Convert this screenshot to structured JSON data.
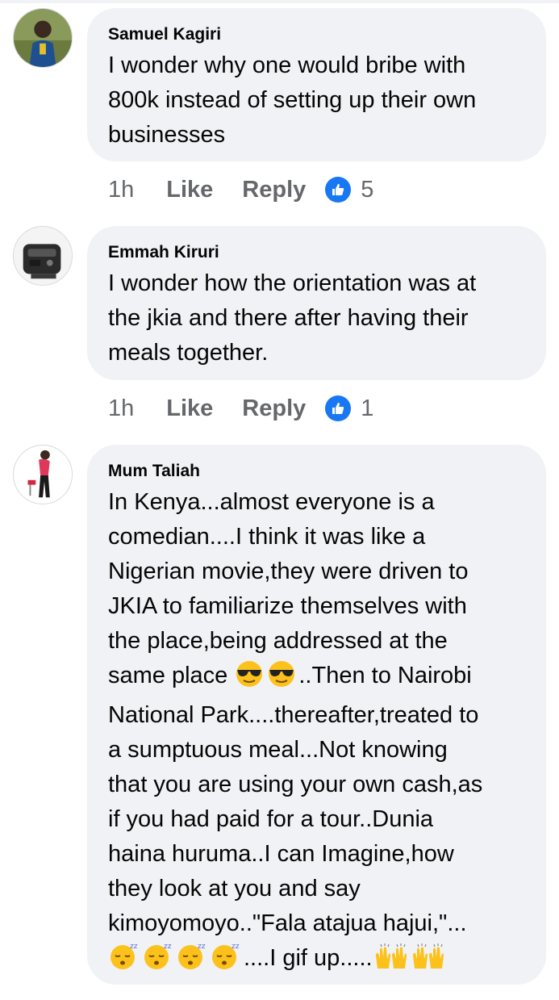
{
  "comments": [
    {
      "author": "Samuel Kagiri",
      "text": "I wonder why one would bribe with\n800k instead of setting up their own\nbusinesses",
      "time": "1h",
      "like_label": "Like",
      "reply_label": "Reply",
      "reaction_count": "5"
    },
    {
      "author": "Emmah Kiruri",
      "text": "I wonder how the orientation was at\nthe jkia and there after having their\nmeals together.",
      "time": "1h",
      "like_label": "Like",
      "reply_label": "Reply",
      "reaction_count": "1"
    },
    {
      "author": "Mum Taliah",
      "text_part1": "In Kenya...almost everyone is a\ncomedian....I think it was like a\nNigerian movie,they were driven to\nJKIA to familiarize themselves with\nthe place,being addressed at the\nsame place ",
      "text_part2": "..Then to Nairobi\nNational Park....thereafter,treated to\na sumptuous meal...Not knowing\nthat you are using your own cash,as\nif you had paid for a tour..Dunia\nhaina huruma..I can Imagine,how\nthey look at you and say\nkimoyomoyo..\"Fala atajua hajui,\"...\n",
      "text_part3": "....I gif up.....",
      "emoji_names": [
        "sunglasses-emoji",
        "sleeping-emoji",
        "raising-hands-emoji"
      ]
    }
  ],
  "colors": {
    "bubble": "#f0f2f5",
    "like_blue": "#1877f2",
    "meta_gray": "#65676b"
  }
}
